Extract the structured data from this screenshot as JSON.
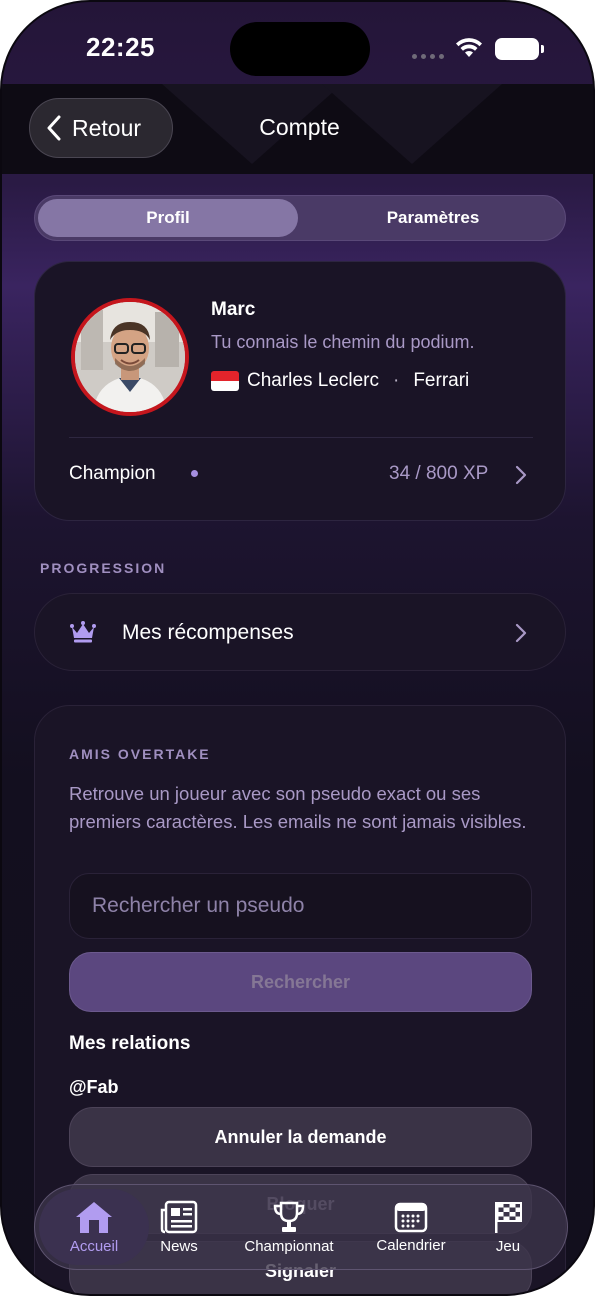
{
  "status_bar": {
    "time": "22:25"
  },
  "nav": {
    "back_label": "Retour",
    "title": "Compte"
  },
  "tabs": {
    "profil": "Profil",
    "parametres": "Paramètres"
  },
  "profile": {
    "name": "Marc",
    "tagline": "Tu connais le chemin du podium.",
    "driver": "Charles Leclerc",
    "separator": "·",
    "team": "Ferrari",
    "level": "Champion",
    "xp": "34 / 800 XP"
  },
  "progression": {
    "section_title": "PROGRESSION",
    "rewards_label": "Mes récompenses"
  },
  "friends": {
    "title": "AMIS OVERTAKE",
    "description": "Retrouve un joueur avec son pseudo exact ou ses premiers caractères. Les emails ne sont jamais visibles.",
    "search_placeholder": "Rechercher un pseudo",
    "search_button": "Rechercher",
    "relations_title": "Mes relations",
    "relation_handle": "@Fab",
    "cancel_request": "Annuler la demande",
    "block": "Bloquer",
    "report": "Signaler"
  },
  "tabbar": {
    "items": [
      {
        "label": "Accueil",
        "icon": "home-icon",
        "active": true
      },
      {
        "label": "News",
        "icon": "newspaper-icon",
        "active": false
      },
      {
        "label": "Championnat",
        "icon": "trophy-icon",
        "active": false
      },
      {
        "label": "Calendrier",
        "icon": "calendar-icon",
        "active": false
      },
      {
        "label": "Jeu",
        "icon": "checkered-flag-icon",
        "active": false
      }
    ]
  },
  "colors": {
    "accent": "#b19cf0",
    "muted_text": "#a999c6",
    "avatar_ring": "#c5161d",
    "segment_active": "#8576a5"
  }
}
